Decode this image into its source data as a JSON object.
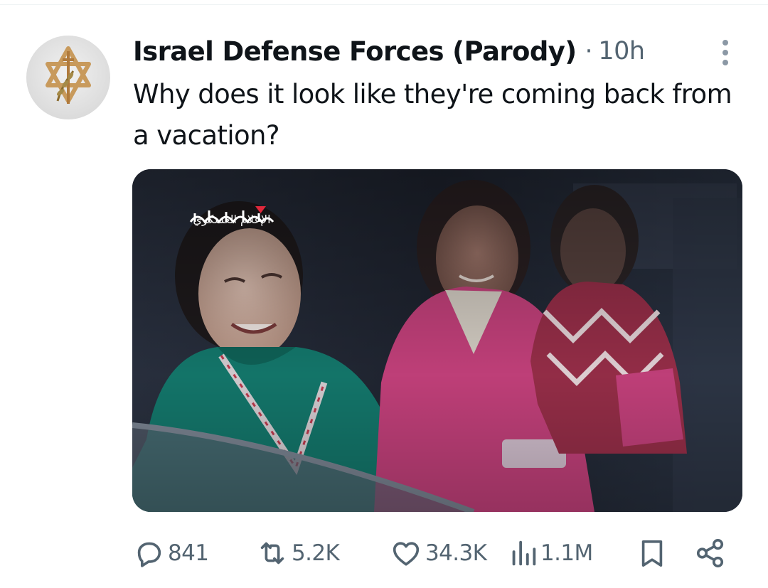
{
  "tweet": {
    "author_name": "Israel Defense Forces (Parody)",
    "separator": "·",
    "timestamp": "10h",
    "text": "Why does it look like they're coming back from a vacation?",
    "avatar_icon": "star-of-david-sword-olive-branch-emblem",
    "media": {
      "watermark_text": "الإعلام العسكري",
      "description_icon": "photo"
    }
  },
  "actions": {
    "replies": {
      "icon": "reply-icon",
      "count": "841"
    },
    "reposts": {
      "icon": "repost-icon",
      "count": "5.2K"
    },
    "likes": {
      "icon": "heart-icon",
      "count": "34.3K"
    },
    "views": {
      "icon": "views-icon",
      "count": "1.1M"
    },
    "bookmark": {
      "icon": "bookmark-icon"
    },
    "share": {
      "icon": "share-icon"
    }
  },
  "colors": {
    "text_primary": "#0f1419",
    "text_secondary": "#536471",
    "divider": "#eff3f4",
    "emblem_gold": "#c89a5c"
  }
}
